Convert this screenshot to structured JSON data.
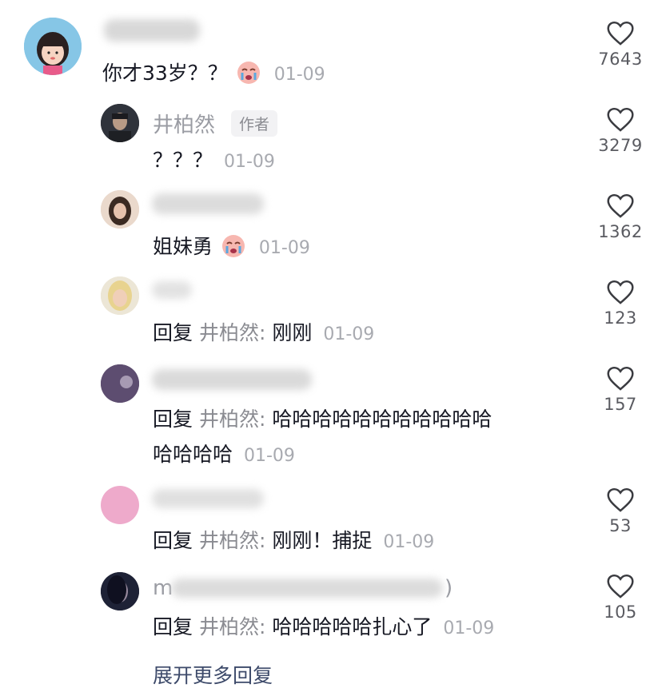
{
  "colors": {
    "text": "#161823",
    "muted": "#9a9ca3",
    "date": "#a8aab0",
    "link": "#3d4a6a"
  },
  "comments": [
    {
      "text": "你才33岁？？",
      "date": "01-09",
      "likes": "7643"
    },
    {
      "author": "井柏然",
      "author_tag": "作者",
      "text": "？？？",
      "date": "01-09",
      "likes": "3279"
    },
    {
      "text": "姐妹勇",
      "date": "01-09",
      "likes": "1362"
    },
    {
      "reply_prefix": "回复",
      "reply_to": "井柏然:",
      "text": "刚刚",
      "date": "01-09",
      "likes": "123"
    },
    {
      "reply_prefix": "回复",
      "reply_to": "井柏然:",
      "text_line1": "哈哈哈哈哈哈哈哈哈哈哈",
      "text_line2": "哈哈哈哈",
      "date": "01-09",
      "likes": "157"
    },
    {
      "reply_prefix": "回复",
      "reply_to": "井柏然:",
      "text": "刚刚！捕捉",
      "date": "01-09",
      "likes": "53"
    },
    {
      "name_partial": "m",
      "name_suffix": ")",
      "reply_prefix": "回复",
      "reply_to": "井柏然:",
      "text": "哈哈哈哈哈扎心了",
      "date": "01-09",
      "likes": "105"
    }
  ],
  "expand_more": "展开更多回复",
  "icons": {
    "like": "heart-outline-icon",
    "emoji": "crying-face-emoji-icon"
  }
}
